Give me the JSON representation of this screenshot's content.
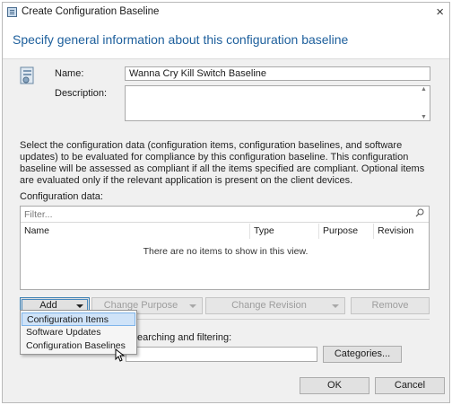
{
  "window": {
    "title": "Create Configuration Baseline",
    "close_symbol": "×"
  },
  "header": {
    "text": "Specify general information about this configuration baseline"
  },
  "form": {
    "name_label": "Name:",
    "name_value": "Wanna Cry Kill Switch Baseline",
    "description_label": "Description:",
    "description_value": ""
  },
  "info_text": "Select the configuration data (configuration items, configuration baselines, and software updates) to be evaluated for compliance by this configuration baseline. This configuration baseline will be assessed as compliant if all the items specified are compliant. Optional items are evaluated only if the relevant application is present on  the client devices.",
  "config_data": {
    "label": "Configuration data:",
    "filter_placeholder": "Filter...",
    "columns": [
      "Name",
      "Type",
      "Purpose",
      "Revision"
    ],
    "empty_message": "There are no items to show in this view."
  },
  "buttons": {
    "add": "Add",
    "change_purpose": "Change Purpose",
    "change_revision": "Change Revision",
    "remove": "Remove",
    "categories": "Categories...",
    "ok": "OK",
    "cancel": "Cancel"
  },
  "add_menu": {
    "items": [
      "Configuration Items",
      "Software Updates",
      "Configuration Baselines"
    ],
    "highlighted_index": 0
  },
  "categories_label_partial": "earching and filtering:",
  "colors": {
    "header_text": "#1d5f9c",
    "menu_highlight": "#cfe3f8"
  }
}
